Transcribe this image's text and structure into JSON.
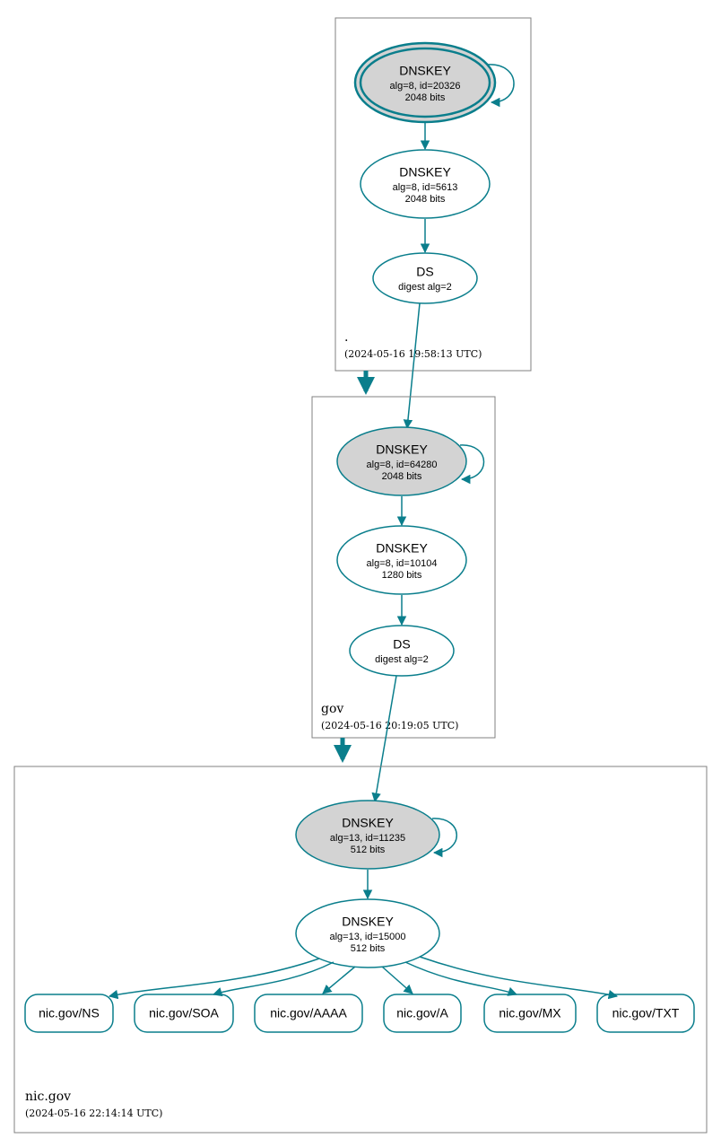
{
  "zones": [
    {
      "name": ".",
      "timestamp": "(2024-05-16 19:58:13 UTC)",
      "nodes": [
        {
          "id": "root-ksk",
          "title": "DNSKEY",
          "line2": "alg=8, id=20326",
          "line3": "2048 bits"
        },
        {
          "id": "root-zsk",
          "title": "DNSKEY",
          "line2": "alg=8, id=5613",
          "line3": "2048 bits"
        },
        {
          "id": "root-ds",
          "title": "DS",
          "line2": "digest alg=2",
          "line3": ""
        }
      ]
    },
    {
      "name": "gov",
      "timestamp": "(2024-05-16 20:19:05 UTC)",
      "nodes": [
        {
          "id": "gov-ksk",
          "title": "DNSKEY",
          "line2": "alg=8, id=64280",
          "line3": "2048 bits"
        },
        {
          "id": "gov-zsk",
          "title": "DNSKEY",
          "line2": "alg=8, id=10104",
          "line3": "1280 bits"
        },
        {
          "id": "gov-ds",
          "title": "DS",
          "line2": "digest alg=2",
          "line3": ""
        }
      ]
    },
    {
      "name": "nic.gov",
      "timestamp": "(2024-05-16 22:14:14 UTC)",
      "nodes": [
        {
          "id": "nic-ksk",
          "title": "DNSKEY",
          "line2": "alg=13, id=11235",
          "line3": "512 bits"
        },
        {
          "id": "nic-zsk",
          "title": "DNSKEY",
          "line2": "alg=13, id=15000",
          "line3": "512 bits"
        }
      ],
      "rrsets": [
        "nic.gov/NS",
        "nic.gov/SOA",
        "nic.gov/AAAA",
        "nic.gov/A",
        "nic.gov/MX",
        "nic.gov/TXT"
      ]
    }
  ]
}
